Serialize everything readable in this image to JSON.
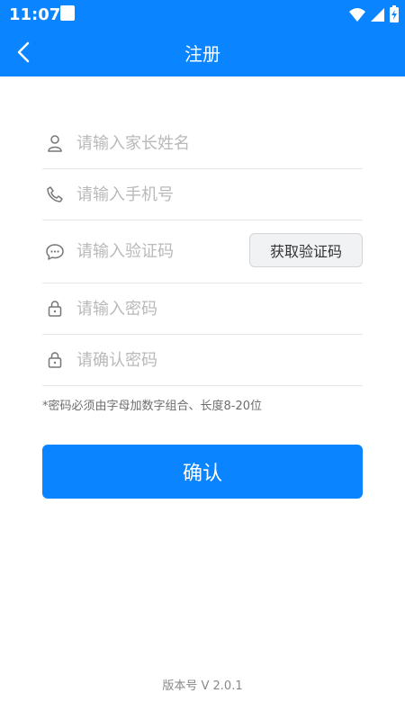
{
  "status_bar": {
    "time": "11:07"
  },
  "header": {
    "title": "注册"
  },
  "form": {
    "parent_name": {
      "placeholder": "请输入家长姓名",
      "value": ""
    },
    "phone": {
      "placeholder": "请输入手机号",
      "value": ""
    },
    "verification": {
      "placeholder": "请输入验证码",
      "value": "",
      "button_label": "获取验证码"
    },
    "password": {
      "placeholder": "请输入密码",
      "value": ""
    },
    "confirm_password": {
      "placeholder": "请确认密码",
      "value": ""
    }
  },
  "password_note": "*密码必须由字母加数字组合、长度8-20位",
  "actions": {
    "confirm_label": "确认"
  },
  "footer": {
    "version": "版本号 V 2.0.1"
  },
  "colors": {
    "primary": "#0a84ff",
    "placeholder": "#b9b9b9",
    "divider": "#e6e6e6"
  }
}
